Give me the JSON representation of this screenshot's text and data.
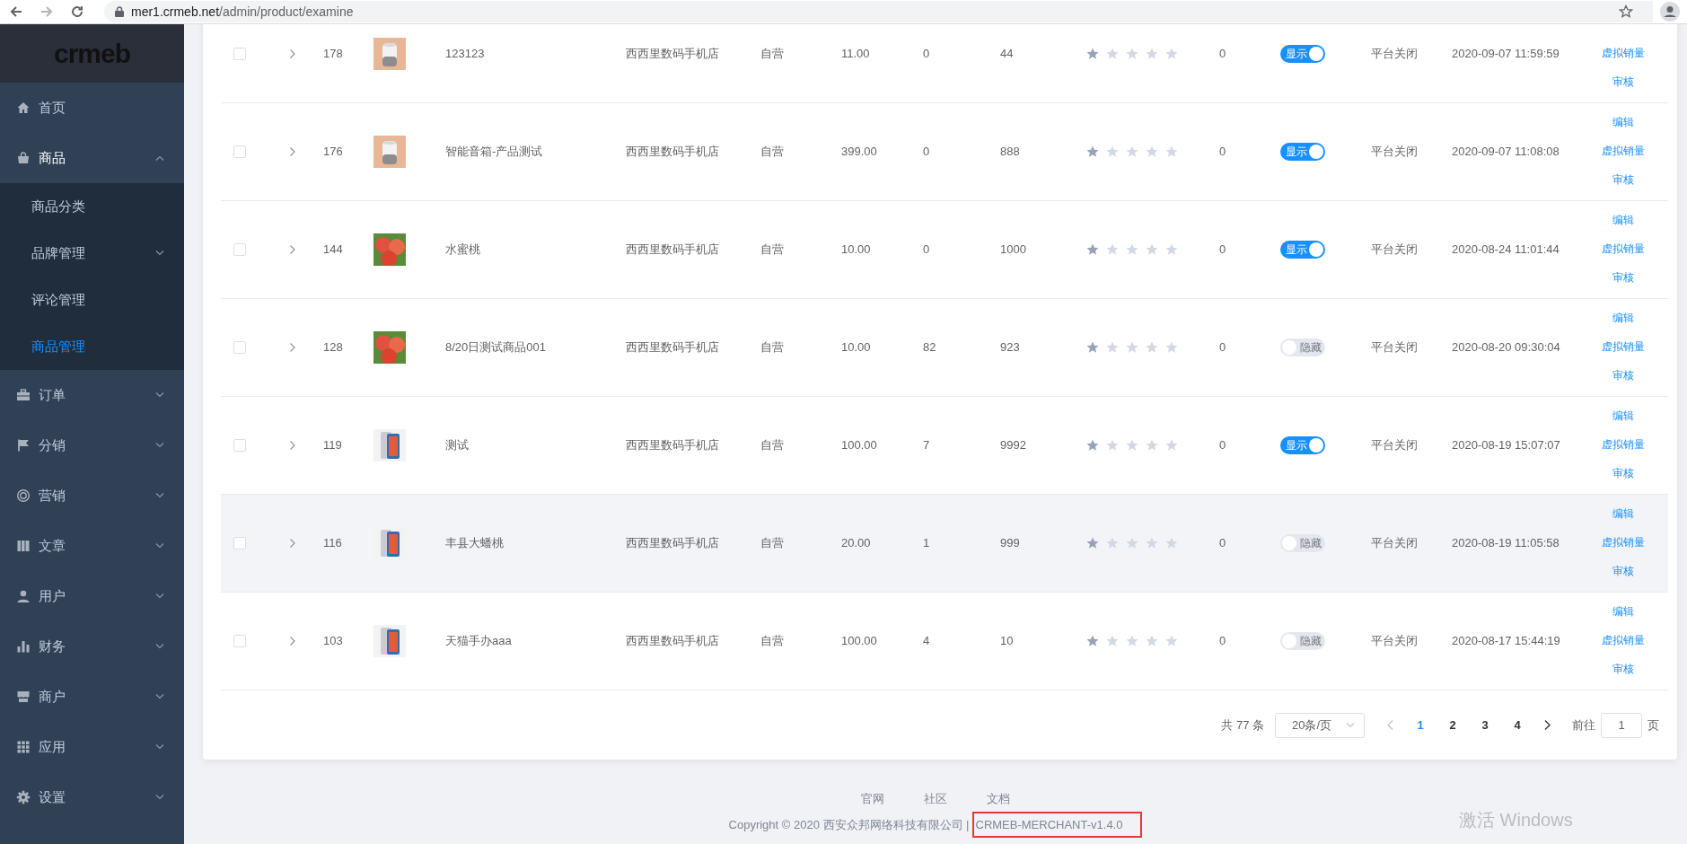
{
  "browser": {
    "url_host": "mer1.crmeb.net",
    "url_path": "/admin/product/examine"
  },
  "sidebar": {
    "logo": "crmeb",
    "items": [
      {
        "label": "首页",
        "kind": "home",
        "expanded": false,
        "has_children": false
      },
      {
        "label": "商品",
        "kind": "bag",
        "expanded": true,
        "has_children": true,
        "children": [
          {
            "label": "商品分类",
            "selected": false,
            "has_children": false
          },
          {
            "label": "品牌管理",
            "selected": false,
            "has_children": true
          },
          {
            "label": "评论管理",
            "selected": false,
            "has_children": false
          },
          {
            "label": "商品管理",
            "selected": true,
            "has_children": false
          }
        ]
      },
      {
        "label": "订单",
        "kind": "briefcase",
        "expanded": false,
        "has_children": true
      },
      {
        "label": "分销",
        "kind": "flag",
        "expanded": false,
        "has_children": true
      },
      {
        "label": "营销",
        "kind": "ring",
        "expanded": false,
        "has_children": true
      },
      {
        "label": "文章",
        "kind": "book",
        "expanded": false,
        "has_children": true
      },
      {
        "label": "用户",
        "kind": "user",
        "expanded": false,
        "has_children": true
      },
      {
        "label": "财务",
        "kind": "chart",
        "expanded": false,
        "has_children": true
      },
      {
        "label": "商户",
        "kind": "store",
        "expanded": false,
        "has_children": true
      },
      {
        "label": "应用",
        "kind": "grid",
        "expanded": false,
        "has_children": true
      },
      {
        "label": "设置",
        "kind": "gear",
        "expanded": false,
        "has_children": true
      }
    ]
  },
  "table": {
    "rows": [
      {
        "checked": false,
        "id": "178",
        "kind": "speaker",
        "name": "123123",
        "store": "西西里数码手机店",
        "type": "自营",
        "price": "11.00",
        "column_8": "0",
        "column_9": "44",
        "stars": 1,
        "column_11": "0",
        "switch": {
          "on": true,
          "label": "显示"
        },
        "status": "平台关闭",
        "date": "2020-09-07 11:59:59",
        "actions": [
          "虚拟销量",
          "审核"
        ],
        "highlighted": false
      },
      {
        "checked": false,
        "id": "176",
        "kind": "speaker",
        "name": "智能音箱-产品测试",
        "store": "西西里数码手机店",
        "type": "自营",
        "price": "399.00",
        "column_8": "0",
        "column_9": "888",
        "stars": 1,
        "column_11": "0",
        "switch": {
          "on": true,
          "label": "显示"
        },
        "status": "平台关闭",
        "date": "2020-09-07 11:08:08",
        "actions": [
          "编辑",
          "虚拟销量",
          "审核"
        ],
        "highlighted": false
      },
      {
        "checked": false,
        "id": "144",
        "kind": "fruit",
        "name": "水蜜桃",
        "store": "西西里数码手机店",
        "type": "自营",
        "price": "10.00",
        "column_8": "0",
        "column_9": "1000",
        "stars": 1,
        "column_11": "0",
        "switch": {
          "on": true,
          "label": "显示"
        },
        "status": "平台关闭",
        "date": "2020-08-24 11:01:44",
        "actions": [
          "编辑",
          "虚拟销量",
          "审核"
        ],
        "highlighted": false
      },
      {
        "checked": false,
        "id": "128",
        "kind": "fruit",
        "name": "8/20日测试商品001",
        "store": "西西里数码手机店",
        "type": "自营",
        "price": "10.00",
        "column_8": "82",
        "column_9": "923",
        "stars": 1,
        "column_11": "0",
        "switch": {
          "on": false,
          "label": "隐藏"
        },
        "status": "平台关闭",
        "date": "2020-08-20 09:30:04",
        "actions": [
          "编辑",
          "虚拟销量",
          "审核"
        ],
        "highlighted": false
      },
      {
        "checked": false,
        "id": "119",
        "kind": "phone",
        "name": "测试",
        "store": "西西里数码手机店",
        "type": "自营",
        "price": "100.00",
        "column_8": "7",
        "column_9": "9992",
        "stars": 1,
        "column_11": "0",
        "switch": {
          "on": true,
          "label": "显示"
        },
        "status": "平台关闭",
        "date": "2020-08-19 15:07:07",
        "actions": [
          "编辑",
          "虚拟销量",
          "审核"
        ],
        "highlighted": false
      },
      {
        "checked": false,
        "id": "116",
        "kind": "phone",
        "name": "丰县大蟠桃",
        "store": "西西里数码手机店",
        "type": "自营",
        "price": "20.00",
        "column_8": "1",
        "column_9": "999",
        "stars": 1,
        "column_11": "0",
        "switch": {
          "on": false,
          "label": "隐藏"
        },
        "status": "平台关闭",
        "date": "2020-08-19 11:05:58",
        "actions": [
          "编辑",
          "虚拟销量",
          "审核"
        ],
        "highlighted": true
      },
      {
        "checked": false,
        "id": "103",
        "kind": "phone",
        "name": "天猫手办aaa",
        "store": "西西里数码手机店",
        "type": "自营",
        "price": "100.00",
        "column_8": "4",
        "column_9": "10",
        "stars": 1,
        "column_11": "0",
        "switch": {
          "on": false,
          "label": "隐藏"
        },
        "status": "平台关闭",
        "date": "2020-08-17 15:44:19",
        "actions": [
          "编辑",
          "虚拟销量",
          "审核"
        ],
        "highlighted": false
      }
    ]
  },
  "pagination": {
    "total": "共 77 条",
    "page_size": "20条/页",
    "pages": [
      {
        "label": "1",
        "selected": true
      },
      {
        "label": "2",
        "selected": false
      },
      {
        "label": "3",
        "selected": false
      },
      {
        "label": "4",
        "selected": false
      }
    ],
    "goto_label": "前往",
    "goto_value": "1",
    "goto_suffix": "页"
  },
  "footer": {
    "links": [
      "官网",
      "社区",
      "文档"
    ],
    "copyright": "Copyright © 2020 西安众邦网络科技有限公司 |",
    "version": "CRMEB-MERCHANT-v1.4.0",
    "version_highlighted": true
  },
  "os_notice": "激活 Windows"
}
